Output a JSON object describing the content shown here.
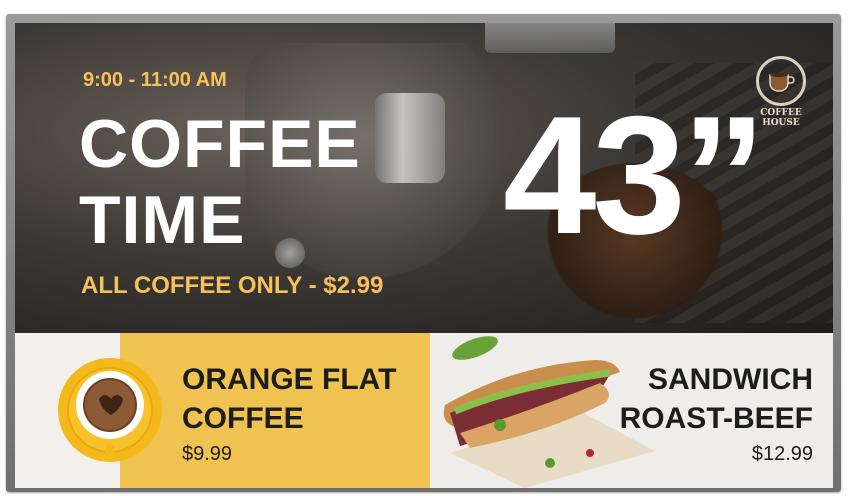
{
  "hero": {
    "time_range": "9:00 - 11:00 AM",
    "headline_line1": "COFFEE",
    "headline_line2": "TIME",
    "promo": "ALL COFFEE ONLY - $2.99",
    "display_size": "43”",
    "logo_text": "COFFEE HOUSE"
  },
  "menu": {
    "items": [
      {
        "name_line1": "ORANGE FLAT",
        "name_line2": "COFFEE",
        "price": "$9.99"
      },
      {
        "name_line1": "SANDWICH",
        "name_line2": "ROAST-BEEF",
        "price": "$12.99"
      }
    ]
  },
  "icons": [
    "coffee-cup-icon",
    "sandwich-image",
    "coffee-house-logo"
  ],
  "colors": {
    "accent": "#f6c15a",
    "panel": "#f0c24f",
    "text_dark": "#1d1d1d"
  }
}
